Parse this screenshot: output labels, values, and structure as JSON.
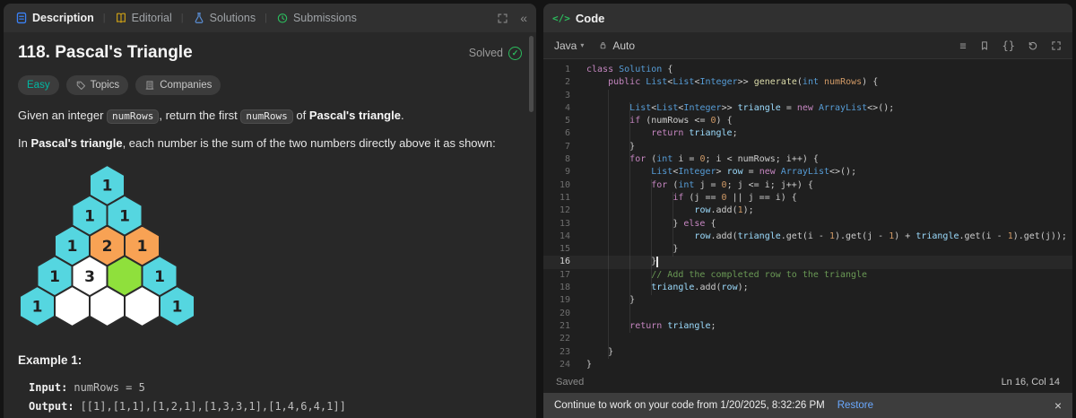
{
  "icons": {
    "code_tag": "</>",
    "chevron_down": "▾",
    "collapse": "«",
    "format": "≡",
    "braces": "{}",
    "close": "×",
    "solved_check": "✓"
  },
  "left_panel": {
    "tabs": [
      {
        "label": "Description"
      },
      {
        "label": "Editorial"
      },
      {
        "label": "Solutions"
      },
      {
        "label": "Submissions"
      }
    ],
    "title": "118. Pascal's Triangle",
    "solved_label": "Solved",
    "badges": {
      "difficulty": "Easy",
      "topics": "Topics",
      "companies": "Companies"
    },
    "paragraph1": [
      {
        "t": "Given an integer "
      },
      {
        "t": "numRows",
        "s": "code"
      },
      {
        "t": ", return the first "
      },
      {
        "t": "numRows",
        "s": "code"
      },
      {
        "t": " of "
      },
      {
        "t": "Pascal's triangle",
        "s": "b"
      },
      {
        "t": "."
      }
    ],
    "paragraph2": [
      {
        "t": "In "
      },
      {
        "t": "Pascal's triangle",
        "s": "b"
      },
      {
        "t": ", each number is the sum of the two numbers directly above it as shown:"
      }
    ],
    "triangle": {
      "stroke": "#2a2a2a",
      "colors": {
        "cyan": "#55d6e0",
        "orange": "#f8a254",
        "green": "#8fe03c",
        "white": "#ffffff"
      },
      "rows": [
        [
          {
            "v": "1",
            "c": "cyan"
          }
        ],
        [
          {
            "v": "1",
            "c": "cyan"
          },
          {
            "v": "1",
            "c": "cyan"
          }
        ],
        [
          {
            "v": "1",
            "c": "cyan"
          },
          {
            "v": "2",
            "c": "orange"
          },
          {
            "v": "1",
            "c": "orange"
          }
        ],
        [
          {
            "v": "1",
            "c": "cyan"
          },
          {
            "v": "3",
            "c": "white"
          },
          {
            "v": "",
            "c": "green"
          },
          {
            "v": "1",
            "c": "cyan"
          }
        ],
        [
          {
            "v": "1",
            "c": "cyan"
          },
          {
            "v": "",
            "c": "white"
          },
          {
            "v": "",
            "c": "white"
          },
          {
            "v": "",
            "c": "white"
          },
          {
            "v": "1",
            "c": "cyan"
          }
        ]
      ]
    },
    "example": {
      "label": "Example 1:",
      "input_label": "Input:",
      "input_value": "numRows = 5",
      "output_label": "Output:",
      "output_value": "[[1],[1,1],[1,2,1],[1,3,3,1],[1,4,6,4,1]]"
    }
  },
  "right_panel": {
    "header": {
      "label": "Code"
    },
    "toolbar": {
      "language": "Java",
      "auto_label": "Auto"
    },
    "editor": {
      "active_line": 16,
      "lines": [
        [
          [
            "class",
            "kw"
          ],
          [
            " ",
            ""
          ],
          [
            "Solution",
            "type"
          ],
          [
            " {",
            ""
          ]
        ],
        [
          [
            "    ",
            ""
          ],
          [
            "public",
            "kw"
          ],
          [
            " ",
            ""
          ],
          [
            "List",
            "type"
          ],
          [
            "<",
            ""
          ],
          [
            "List",
            "type"
          ],
          [
            "<",
            ""
          ],
          [
            "Integer",
            "type"
          ],
          [
            ">> ",
            ""
          ],
          [
            "generate",
            "fn"
          ],
          [
            "(",
            ""
          ],
          [
            "int",
            "type"
          ],
          [
            " ",
            ""
          ],
          [
            "numRows",
            "num"
          ],
          [
            ") {",
            ""
          ]
        ],
        [],
        [
          [
            "        ",
            ""
          ],
          [
            "List",
            "type"
          ],
          [
            "<",
            ""
          ],
          [
            "List",
            "type"
          ],
          [
            "<",
            ""
          ],
          [
            "Integer",
            "type"
          ],
          [
            ">> ",
            ""
          ],
          [
            "triangle",
            "var"
          ],
          [
            " = ",
            ""
          ],
          [
            "new",
            "kw"
          ],
          [
            " ",
            ""
          ],
          [
            "ArrayList",
            "type"
          ],
          [
            "<>();",
            ""
          ]
        ],
        [
          [
            "        ",
            ""
          ],
          [
            "if",
            "kw"
          ],
          [
            " (numRows <= ",
            ""
          ],
          [
            "0",
            "num"
          ],
          [
            ") {",
            ""
          ]
        ],
        [
          [
            "            ",
            ""
          ],
          [
            "return",
            "kw"
          ],
          [
            " ",
            ""
          ],
          [
            "triangle",
            "var"
          ],
          [
            ";",
            ""
          ]
        ],
        [
          [
            "        }",
            ""
          ]
        ],
        [
          [
            "        ",
            ""
          ],
          [
            "for",
            "kw"
          ],
          [
            " (",
            ""
          ],
          [
            "int",
            "type"
          ],
          [
            " i = ",
            ""
          ],
          [
            "0",
            "num"
          ],
          [
            "; i < numRows; i++) {",
            ""
          ]
        ],
        [
          [
            "            ",
            ""
          ],
          [
            "List",
            "type"
          ],
          [
            "<",
            ""
          ],
          [
            "Integer",
            "type"
          ],
          [
            "> ",
            ""
          ],
          [
            "row",
            "var"
          ],
          [
            " = ",
            ""
          ],
          [
            "new",
            "kw"
          ],
          [
            " ",
            ""
          ],
          [
            "ArrayList",
            "type"
          ],
          [
            "<>();",
            ""
          ]
        ],
        [
          [
            "            ",
            ""
          ],
          [
            "for",
            "kw"
          ],
          [
            " (",
            ""
          ],
          [
            "int",
            "type"
          ],
          [
            " j = ",
            ""
          ],
          [
            "0",
            "num"
          ],
          [
            "; j <= i; j++) {",
            ""
          ]
        ],
        [
          [
            "                ",
            ""
          ],
          [
            "if",
            "kw"
          ],
          [
            " (j == ",
            ""
          ],
          [
            "0",
            "num"
          ],
          [
            " || j == i) {",
            ""
          ]
        ],
        [
          [
            "                    ",
            ""
          ],
          [
            "row",
            "var"
          ],
          [
            ".add(",
            ""
          ],
          [
            "1",
            "num"
          ],
          [
            ");",
            ""
          ]
        ],
        [
          [
            "                } ",
            ""
          ],
          [
            "else",
            "kw"
          ],
          [
            " {",
            ""
          ]
        ],
        [
          [
            "                    ",
            ""
          ],
          [
            "row",
            "var"
          ],
          [
            ".add(",
            ""
          ],
          [
            "triangle",
            "var"
          ],
          [
            ".get(i - ",
            ""
          ],
          [
            "1",
            "num"
          ],
          [
            ").get(j - ",
            ""
          ],
          [
            "1",
            "num"
          ],
          [
            ") + ",
            ""
          ],
          [
            "triangle",
            "var"
          ],
          [
            ".get(i - ",
            ""
          ],
          [
            "1",
            "num"
          ],
          [
            ").get(j));",
            ""
          ]
        ],
        [
          [
            "                }",
            ""
          ]
        ],
        [
          [
            "            }",
            ""
          ]
        ],
        [
          [
            "            ",
            ""
          ],
          [
            "// Add the completed row to the triangle",
            "comment"
          ]
        ],
        [
          [
            "            ",
            ""
          ],
          [
            "triangle",
            "var"
          ],
          [
            ".add(",
            ""
          ],
          [
            "row",
            "var"
          ],
          [
            ");",
            ""
          ]
        ],
        [
          [
            "        }",
            ""
          ]
        ],
        [],
        [
          [
            "        ",
            ""
          ],
          [
            "return",
            "kw"
          ],
          [
            " ",
            ""
          ],
          [
            "triangle",
            "var"
          ],
          [
            ";",
            ""
          ]
        ],
        [],
        [
          [
            "    }",
            ""
          ]
        ],
        [
          [
            "}",
            ""
          ]
        ]
      ]
    },
    "status": {
      "saved": "Saved",
      "position": "Ln 16, Col 14"
    },
    "notification": {
      "message": "Continue to work on your code from 1/20/2025, 8:32:26 PM",
      "action": "Restore"
    }
  }
}
